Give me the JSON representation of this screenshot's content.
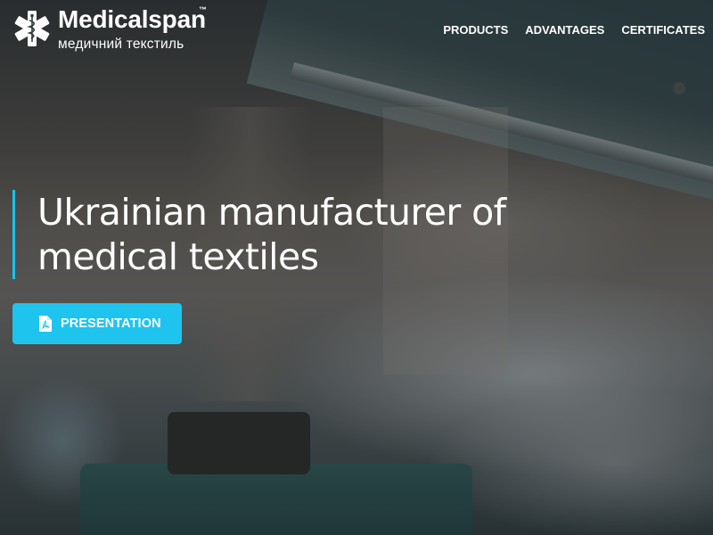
{
  "brand": {
    "name": "Medicalspan",
    "trademark": "™",
    "tagline": "медичний текстиль",
    "logo_icon": "star-of-life-icon"
  },
  "nav": {
    "items": [
      {
        "label": "PRODUCTS"
      },
      {
        "label": "ADVANTAGES"
      },
      {
        "label": "CERTIFICATES"
      }
    ]
  },
  "hero": {
    "headline_line1": "Ukrainian manufacturer of",
    "headline_line2": "medical textiles",
    "cta_label": "PRESENTATION",
    "cta_icon": "pdf-file-icon"
  },
  "colors": {
    "accent": "#1fc4ee",
    "text": "#ffffff"
  }
}
